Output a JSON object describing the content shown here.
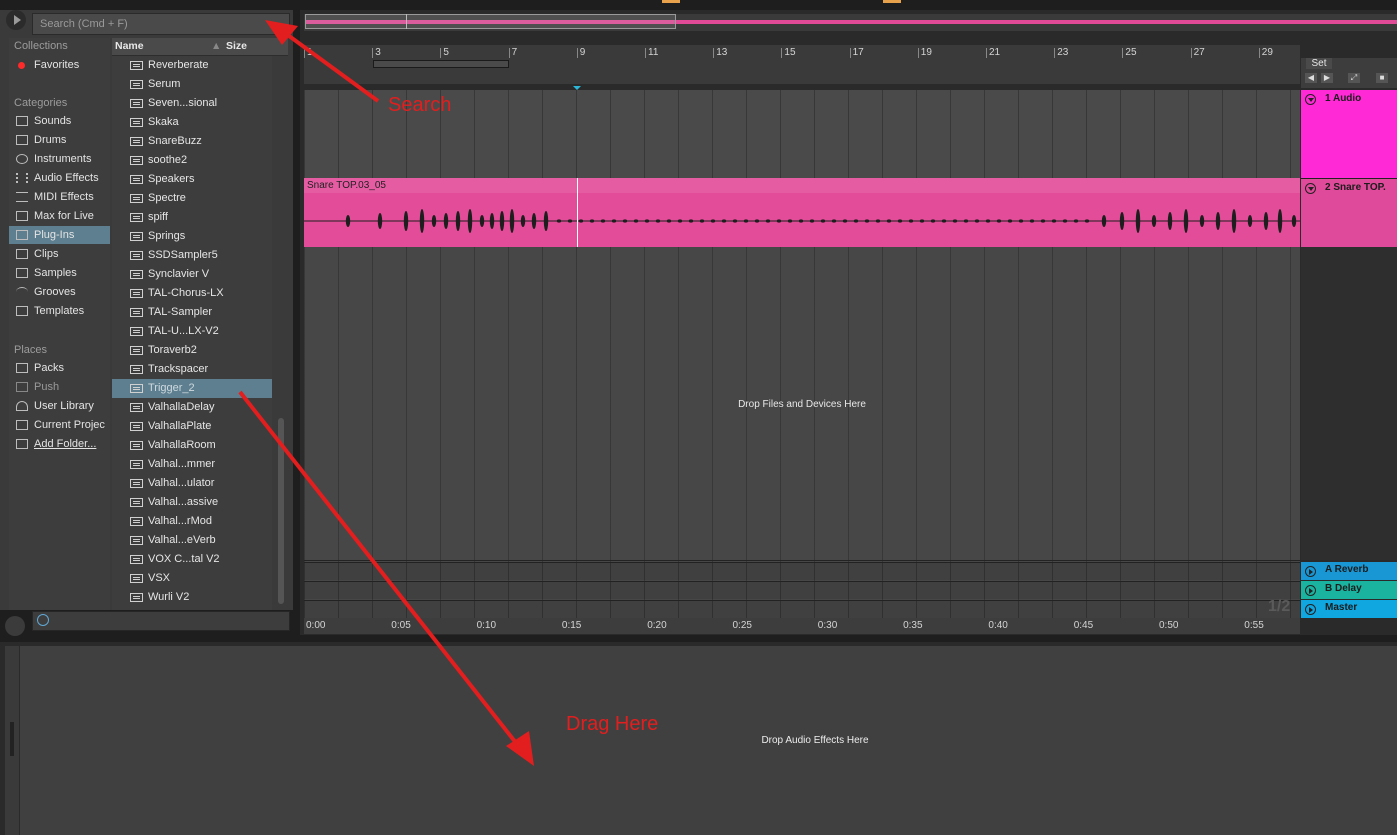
{
  "browser": {
    "search_placeholder": "Search (Cmd + F)",
    "sections": {
      "collections": "Collections",
      "categories": "Categories",
      "places": "Places"
    },
    "collections": [
      {
        "label": "Favorites",
        "icon": "red-dot-icon",
        "color": "#ff2a2a"
      }
    ],
    "categories": [
      {
        "label": "Sounds",
        "icon": "note-icon"
      },
      {
        "label": "Drums",
        "icon": "drum-grid-icon"
      },
      {
        "label": "Instruments",
        "icon": "clock-icon"
      },
      {
        "label": "Audio Effects",
        "icon": "waveform-icon"
      },
      {
        "label": "MIDI Effects",
        "icon": "midi-lines-icon"
      },
      {
        "label": "Max for Live",
        "icon": "max-icon"
      },
      {
        "label": "Plug-Ins",
        "icon": "plugin-icon",
        "selected": true
      },
      {
        "label": "Clips",
        "icon": "clip-icon"
      },
      {
        "label": "Samples",
        "icon": "sample-icon"
      },
      {
        "label": "Grooves",
        "icon": "groove-icon"
      },
      {
        "label": "Templates",
        "icon": "template-icon"
      }
    ],
    "places": [
      {
        "label": "Packs",
        "icon": "packs-icon"
      },
      {
        "label": "Push",
        "icon": "push-icon",
        "dimmed": true
      },
      {
        "label": "User Library",
        "icon": "user-icon"
      },
      {
        "label": "Current Projec",
        "icon": "project-icon"
      },
      {
        "label": "Add Folder...",
        "icon": "add-folder-icon"
      }
    ],
    "columns": {
      "name": "Name",
      "size": "Size"
    },
    "files": [
      "Reverberate",
      "Serum",
      "Seven...sional",
      "Skaka",
      "SnareBuzz",
      "soothe2",
      "Speakers",
      "Spectre",
      "spiff",
      "Springs",
      "SSDSampler5",
      "Synclavier V",
      "TAL-Chorus-LX",
      "TAL-Sampler",
      "TAL-U...LX-V2",
      "Toraverb2",
      "Trackspacer",
      "Trigger_2",
      "ValhallaDelay",
      "ValhallaPlate",
      "ValhallaRoom",
      "Valhal...mmer",
      "Valhal...ulator",
      "Valhal...assive",
      "Valhal...rMod",
      "Valhal...eVerb",
      "VOX C...tal V2",
      "VSX",
      "Wurli V2"
    ],
    "selected_file": "Trigger_2"
  },
  "arrangement": {
    "bar_numbers": [
      "1",
      "3",
      "5",
      "7",
      "9",
      "11",
      "13",
      "15",
      "17",
      "19",
      "21",
      "23",
      "25",
      "27",
      "29"
    ],
    "time_labels": [
      "0:00",
      "0:05",
      "0:10",
      "0:15",
      "0:20",
      "0:25",
      "0:30",
      "0:35",
      "0:40",
      "0:45",
      "0:50",
      "0:55"
    ],
    "clip_name": "Snare TOP.03_05",
    "clip_color": "#e34c98",
    "drop_files_text": "Drop Files and Devices Here",
    "page_indicator": "1/2",
    "set_label": "Set"
  },
  "tracks": [
    {
      "name": "1 Audio",
      "color": "#ff2ad6"
    },
    {
      "name": "2 Snare TOP.",
      "color": "#e04a9a"
    }
  ],
  "returns": [
    {
      "name": "A Reverb",
      "color": "#1897d4"
    },
    {
      "name": "B Delay",
      "color": "#19b39f"
    },
    {
      "name": "Master",
      "color": "#10a6df"
    }
  ],
  "device_view": {
    "drop_text": "Drop Audio Effects Here"
  },
  "annotations": {
    "search": "Search",
    "drag": "Drag Here",
    "color": "#e21e1e"
  }
}
